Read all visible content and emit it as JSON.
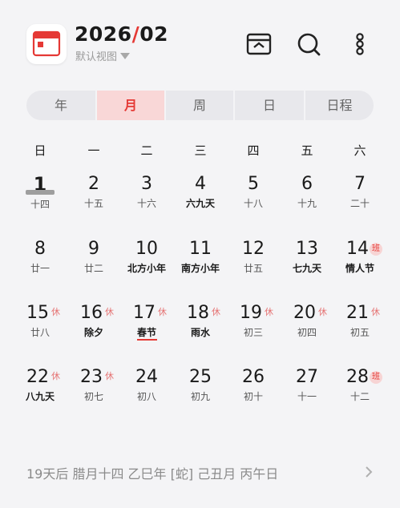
{
  "header": {
    "title_year": "2026",
    "title_slash": "/",
    "title_month": "02",
    "view_label": "默认视图",
    "icons": [
      "calendar-app-icon",
      "inbox-icon",
      "search-icon",
      "more-icon"
    ]
  },
  "tabs": [
    {
      "label": "年"
    },
    {
      "label": "月"
    },
    {
      "label": "周"
    },
    {
      "label": "日"
    },
    {
      "label": "日程"
    }
  ],
  "active_tab": "月",
  "weekdays": [
    "日",
    "一",
    "二",
    "三",
    "四",
    "五",
    "六"
  ],
  "weeks": [
    [
      {
        "day": "1",
        "sub": "十四"
      },
      {
        "day": "2",
        "sub": "十五"
      },
      {
        "day": "3",
        "sub": "十六"
      },
      {
        "day": "4",
        "sub": "六九天"
      },
      {
        "day": "5",
        "sub": "十八"
      },
      {
        "day": "6",
        "sub": "十九"
      },
      {
        "day": "7",
        "sub": "二十"
      }
    ],
    [
      {
        "day": "8",
        "sub": "廿一"
      },
      {
        "day": "9",
        "sub": "廿二"
      },
      {
        "day": "10",
        "sub": "北方小年"
      },
      {
        "day": "11",
        "sub": "南方小年"
      },
      {
        "day": "12",
        "sub": "廿五"
      },
      {
        "day": "13",
        "sub": "七九天"
      },
      {
        "day": "14",
        "sub": "情人节",
        "badge": "班"
      }
    ],
    [
      {
        "day": "15",
        "sub": "廿八",
        "badge": "休"
      },
      {
        "day": "16",
        "sub": "除夕",
        "badge": "休"
      },
      {
        "day": "17",
        "sub": "春节",
        "badge": "休"
      },
      {
        "day": "18",
        "sub": "雨水",
        "badge": "休"
      },
      {
        "day": "19",
        "sub": "初三",
        "badge": "休"
      },
      {
        "day": "20",
        "sub": "初四",
        "badge": "休"
      },
      {
        "day": "21",
        "sub": "初五",
        "badge": "休"
      }
    ],
    [
      {
        "day": "22",
        "sub": "八九天",
        "badge": "休"
      },
      {
        "day": "23",
        "sub": "初七",
        "badge": "休"
      },
      {
        "day": "24",
        "sub": "初八"
      },
      {
        "day": "25",
        "sub": "初九"
      },
      {
        "day": "26",
        "sub": "初十"
      },
      {
        "day": "27",
        "sub": "十一"
      },
      {
        "day": "28",
        "sub": "十二",
        "badge": "班"
      }
    ]
  ],
  "footer": {
    "text": "19天后  腊月十四  乙巳年 [蛇] 己丑月 丙午日"
  },
  "colors": {
    "accent": "#e53935",
    "active_tab_bg": "#f9d7d7",
    "background": "#f4f4f6"
  }
}
